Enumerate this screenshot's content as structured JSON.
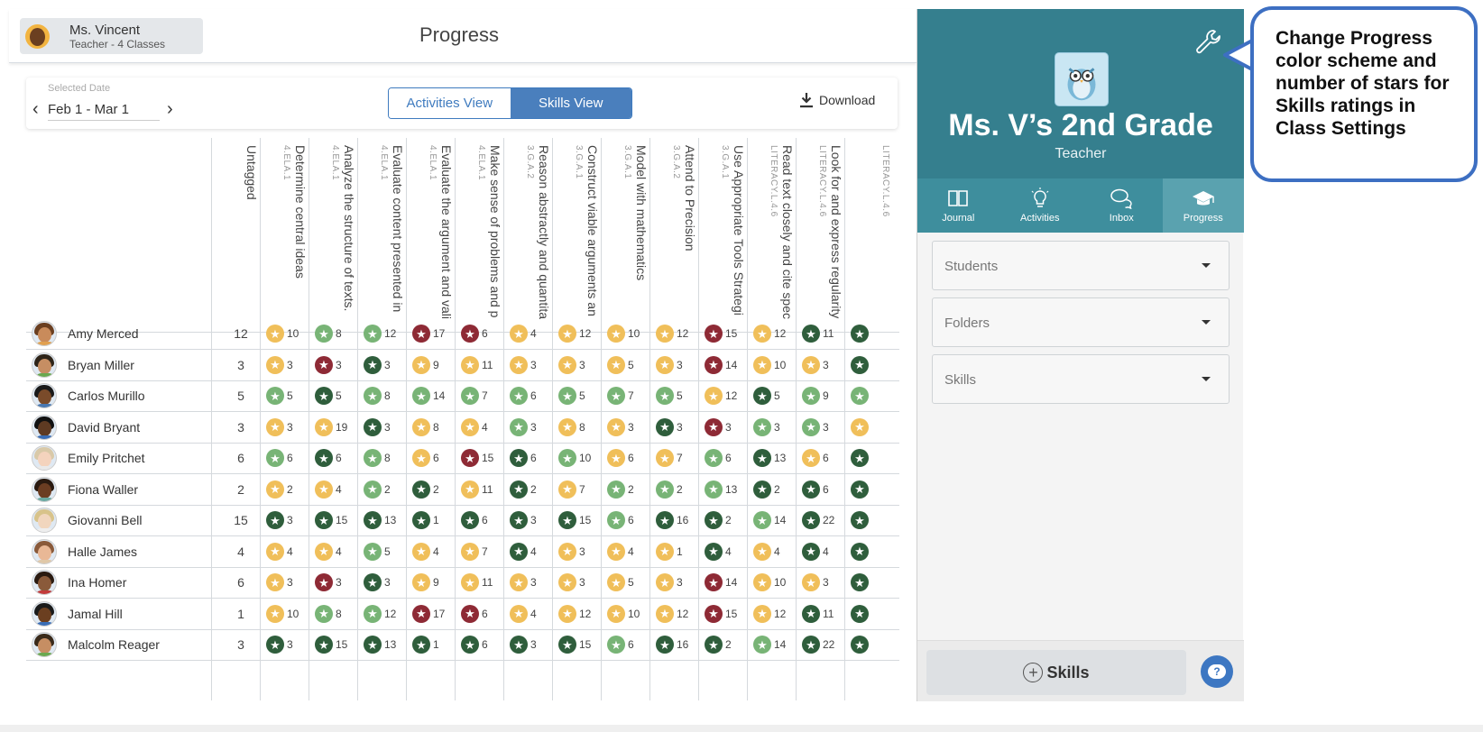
{
  "header": {
    "user_name": "Ms. Vincent",
    "user_sub": "Teacher - 4 Classes",
    "page_title": "Progress"
  },
  "controls": {
    "date_label": "Selected Date",
    "date_value": "Feb 1 - Mar 1",
    "prev": "‹",
    "next": "›",
    "view_activities": "Activities View",
    "view_skills": "Skills View",
    "download": "Download"
  },
  "table": {
    "columns": [
      {
        "name": "Untagged",
        "code": ""
      },
      {
        "name": "Determine central ideas",
        "code": "4.ELA.1"
      },
      {
        "name": "Analyze the structure of texts.",
        "code": "4.ELA.1"
      },
      {
        "name": "Evaluate content presented in",
        "code": "4.ELA.1"
      },
      {
        "name": "Evaluate the argument and vali",
        "code": "4.ELA.1"
      },
      {
        "name": "Make sense of problems and p",
        "code": "4.ELA.1"
      },
      {
        "name": "Reason abstractly and quantita",
        "code": "3.G.A.2"
      },
      {
        "name": "Construct viable arguments an",
        "code": "3.G.A.1"
      },
      {
        "name": "Model with mathematics",
        "code": "3.G.A.1"
      },
      {
        "name": "Attend to Precision",
        "code": "3.G.A.2"
      },
      {
        "name": "Use Appropriate Tools Strategi",
        "code": "3.G.A.1"
      },
      {
        "name": "Read text closely and cite spec",
        "code": "LITERACY.L.4.6"
      },
      {
        "name": "Look for and express regularity",
        "code": "LITERACY.L.4.6"
      },
      {
        "name": "",
        "code": "LITERACY.L.4.6"
      }
    ],
    "rows": [
      {
        "name": "Amy Merced",
        "untagged": "12",
        "cells": [
          [
            "y",
            "10"
          ],
          [
            "g",
            "8"
          ],
          [
            "g",
            "12"
          ],
          [
            "r",
            "17"
          ],
          [
            "r",
            "6"
          ],
          [
            "y",
            "4"
          ],
          [
            "y",
            "12"
          ],
          [
            "y",
            "10"
          ],
          [
            "y",
            "12"
          ],
          [
            "r",
            "15"
          ],
          [
            "y",
            "12"
          ],
          [
            "d",
            "11"
          ],
          [
            "d",
            ""
          ]
        ]
      },
      {
        "name": "Bryan Miller",
        "untagged": "3",
        "cells": [
          [
            "y",
            "3"
          ],
          [
            "r",
            "3"
          ],
          [
            "d",
            "3"
          ],
          [
            "y",
            "9"
          ],
          [
            "y",
            "11"
          ],
          [
            "y",
            "3"
          ],
          [
            "y",
            "3"
          ],
          [
            "y",
            "5"
          ],
          [
            "y",
            "3"
          ],
          [
            "r",
            "14"
          ],
          [
            "y",
            "10"
          ],
          [
            "y",
            "3"
          ],
          [
            "d",
            ""
          ]
        ]
      },
      {
        "name": "Carlos Murillo",
        "untagged": "5",
        "cells": [
          [
            "g",
            "5"
          ],
          [
            "d",
            "5"
          ],
          [
            "g",
            "8"
          ],
          [
            "g",
            "14"
          ],
          [
            "g",
            "7"
          ],
          [
            "g",
            "6"
          ],
          [
            "g",
            "5"
          ],
          [
            "g",
            "7"
          ],
          [
            "g",
            "5"
          ],
          [
            "y",
            "12"
          ],
          [
            "d",
            "5"
          ],
          [
            "g",
            "9"
          ],
          [
            "g",
            ""
          ]
        ]
      },
      {
        "name": "David Bryant",
        "untagged": "3",
        "cells": [
          [
            "y",
            "3"
          ],
          [
            "y",
            "19"
          ],
          [
            "d",
            "3"
          ],
          [
            "y",
            "8"
          ],
          [
            "y",
            "4"
          ],
          [
            "g",
            "3"
          ],
          [
            "y",
            "8"
          ],
          [
            "y",
            "3"
          ],
          [
            "d",
            "3"
          ],
          [
            "r",
            "3"
          ],
          [
            "g",
            "3"
          ],
          [
            "g",
            "3"
          ],
          [
            "y",
            ""
          ]
        ]
      },
      {
        "name": "Emily Pritchet",
        "untagged": "6",
        "cells": [
          [
            "g",
            "6"
          ],
          [
            "d",
            "6"
          ],
          [
            "g",
            "8"
          ],
          [
            "y",
            "6"
          ],
          [
            "r",
            "15"
          ],
          [
            "d",
            "6"
          ],
          [
            "g",
            "10"
          ],
          [
            "y",
            "6"
          ],
          [
            "y",
            "7"
          ],
          [
            "g",
            "6"
          ],
          [
            "d",
            "13"
          ],
          [
            "y",
            "6"
          ],
          [
            "d",
            ""
          ]
        ]
      },
      {
        "name": "Fiona Waller",
        "untagged": "2",
        "cells": [
          [
            "y",
            "2"
          ],
          [
            "y",
            "4"
          ],
          [
            "g",
            "2"
          ],
          [
            "d",
            "2"
          ],
          [
            "y",
            "11"
          ],
          [
            "d",
            "2"
          ],
          [
            "y",
            "7"
          ],
          [
            "g",
            "2"
          ],
          [
            "g",
            "2"
          ],
          [
            "g",
            "13"
          ],
          [
            "d",
            "2"
          ],
          [
            "d",
            "6"
          ],
          [
            "d",
            ""
          ]
        ]
      },
      {
        "name": "Giovanni Bell",
        "untagged": "15",
        "cells": [
          [
            "d",
            "3"
          ],
          [
            "d",
            "15"
          ],
          [
            "d",
            "13"
          ],
          [
            "d",
            "1"
          ],
          [
            "d",
            "6"
          ],
          [
            "d",
            "3"
          ],
          [
            "d",
            "15"
          ],
          [
            "g",
            "6"
          ],
          [
            "d",
            "16"
          ],
          [
            "d",
            "2"
          ],
          [
            "g",
            "14"
          ],
          [
            "d",
            "22"
          ],
          [
            "d",
            ""
          ]
        ]
      },
      {
        "name": "Halle James",
        "untagged": "4",
        "cells": [
          [
            "y",
            "4"
          ],
          [
            "y",
            "4"
          ],
          [
            "g",
            "5"
          ],
          [
            "y",
            "4"
          ],
          [
            "y",
            "7"
          ],
          [
            "d",
            "4"
          ],
          [
            "y",
            "3"
          ],
          [
            "y",
            "4"
          ],
          [
            "y",
            "1"
          ],
          [
            "d",
            "4"
          ],
          [
            "y",
            "4"
          ],
          [
            "d",
            "4"
          ],
          [
            "d",
            ""
          ]
        ]
      },
      {
        "name": "Ina Homer",
        "untagged": "6",
        "cells": [
          [
            "y",
            "3"
          ],
          [
            "r",
            "3"
          ],
          [
            "d",
            "3"
          ],
          [
            "y",
            "9"
          ],
          [
            "y",
            "11"
          ],
          [
            "y",
            "3"
          ],
          [
            "y",
            "3"
          ],
          [
            "y",
            "5"
          ],
          [
            "y",
            "3"
          ],
          [
            "r",
            "14"
          ],
          [
            "y",
            "10"
          ],
          [
            "y",
            "3"
          ],
          [
            "d",
            ""
          ]
        ]
      },
      {
        "name": "Jamal Hill",
        "untagged": "1",
        "cells": [
          [
            "y",
            "10"
          ],
          [
            "g",
            "8"
          ],
          [
            "g",
            "12"
          ],
          [
            "r",
            "17"
          ],
          [
            "r",
            "6"
          ],
          [
            "y",
            "4"
          ],
          [
            "y",
            "12"
          ],
          [
            "y",
            "10"
          ],
          [
            "y",
            "12"
          ],
          [
            "r",
            "15"
          ],
          [
            "y",
            "12"
          ],
          [
            "d",
            "11"
          ],
          [
            "d",
            ""
          ]
        ]
      },
      {
        "name": "Malcolm Reager",
        "untagged": "3",
        "cells": [
          [
            "d",
            "3"
          ],
          [
            "d",
            "15"
          ],
          [
            "d",
            "13"
          ],
          [
            "d",
            "1"
          ],
          [
            "d",
            "6"
          ],
          [
            "d",
            "3"
          ],
          [
            "d",
            "15"
          ],
          [
            "g",
            "6"
          ],
          [
            "d",
            "16"
          ],
          [
            "d",
            "2"
          ],
          [
            "g",
            "14"
          ],
          [
            "d",
            "22"
          ],
          [
            "d",
            ""
          ]
        ]
      }
    ]
  },
  "colors": {
    "y": "#f0bf5a",
    "g": "#78b476",
    "d": "#2f5e3c",
    "r": "#8e2a35",
    "accent": "#357f8e"
  },
  "panel": {
    "class_title": "Ms. V’s 2nd Grade",
    "class_sub": "Teacher",
    "nav": [
      "Journal",
      "Activities",
      "Inbox",
      "Progress"
    ],
    "dropdowns": [
      "Students",
      "Folders",
      "Skills"
    ],
    "add_skills": "Skills"
  },
  "callout": {
    "text": "Change Progress color scheme and number of stars for Skills ratings in Class Settings"
  }
}
